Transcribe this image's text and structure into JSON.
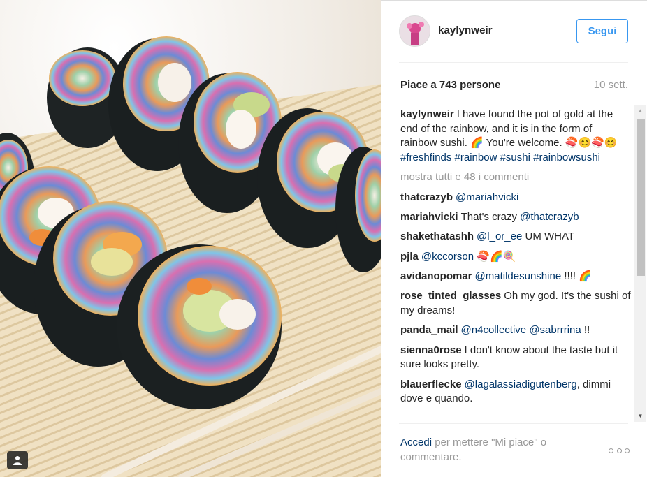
{
  "header": {
    "username": "kaylynweir",
    "follow_label": "Segui"
  },
  "stats": {
    "likes": "Piace a 743 persone",
    "date": "10 sett."
  },
  "caption": {
    "author": "kaylynweir",
    "text": "I have found the pot of gold at the end of the rainbow, and it is in the form of rainbow sushi. 🌈 You're welcome. 🍣😊🍣😊 ",
    "hashtags": [
      "#freshfinds",
      "#rainbow",
      "#sushi",
      "#rainbowsushi"
    ]
  },
  "load_more": "mostra tutti e 48 i commenti",
  "comments": [
    {
      "author": "thatcrazyb",
      "pre": "",
      "mentions": [
        "@mariahvicki"
      ],
      "post": ""
    },
    {
      "author": "mariahvicki",
      "pre": "That's crazy ",
      "mentions": [
        "@thatcrazyb"
      ],
      "post": ""
    },
    {
      "author": "shakethatashh",
      "pre": "",
      "mentions": [
        "@l_or_ee"
      ],
      "post": " UM WHAT"
    },
    {
      "author": "pjla",
      "pre": "",
      "mentions": [
        "@kccorson"
      ],
      "post": " 🍣🌈🍭"
    },
    {
      "author": "avidanopomar",
      "pre": "",
      "mentions": [
        "@matildesunshine"
      ],
      "post": " !!!! 🌈"
    },
    {
      "author": "rose_tinted_glasses",
      "pre": "Oh my god. It's the sushi of my dreams!",
      "mentions": [],
      "post": ""
    },
    {
      "author": "panda_mail",
      "pre": "",
      "mentions": [
        "@n4collective",
        "@sabrrrina"
      ],
      "post": " !!"
    },
    {
      "author": "sienna0rose",
      "pre": "I don't know about the taste but it sure looks pretty.",
      "mentions": [],
      "post": ""
    },
    {
      "author": "blauerflecke",
      "pre": "",
      "mentions": [
        "@lagalassiadigutenberg"
      ],
      "post": ", dimmi dove e quando."
    }
  ],
  "footer": {
    "login_label": "Accedi",
    "rest": " per mettere \"Mi piace\" o commentare."
  },
  "icons": {
    "user_tag": "person-icon",
    "more": "more-options-icon",
    "scroll_up": "chevron-up-icon",
    "scroll_down": "chevron-down-icon"
  },
  "colors": {
    "link": "#003569",
    "follow": "#3897f0",
    "muted": "#999999"
  }
}
